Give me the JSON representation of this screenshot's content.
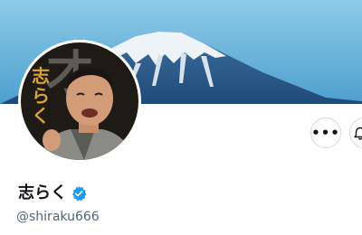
{
  "profile": {
    "display_name": "志らく",
    "handle": "@shiraku666",
    "verified": true
  },
  "banner": {
    "description_icon": "mountain-fuji-banner"
  },
  "avatar": {
    "icon": "profile-photo",
    "overlay_text_kanji": "才",
    "overlay_text_kana": "志らく"
  },
  "actions": {
    "more_icon": "more-horizontal-icon",
    "more_label": "•••",
    "notify_icon": "bell-icon"
  },
  "colors": {
    "verified_badge": "#1d9bf0",
    "name_text": "#0f1419",
    "handle_text": "#536471",
    "button_border": "#cfd9de"
  }
}
